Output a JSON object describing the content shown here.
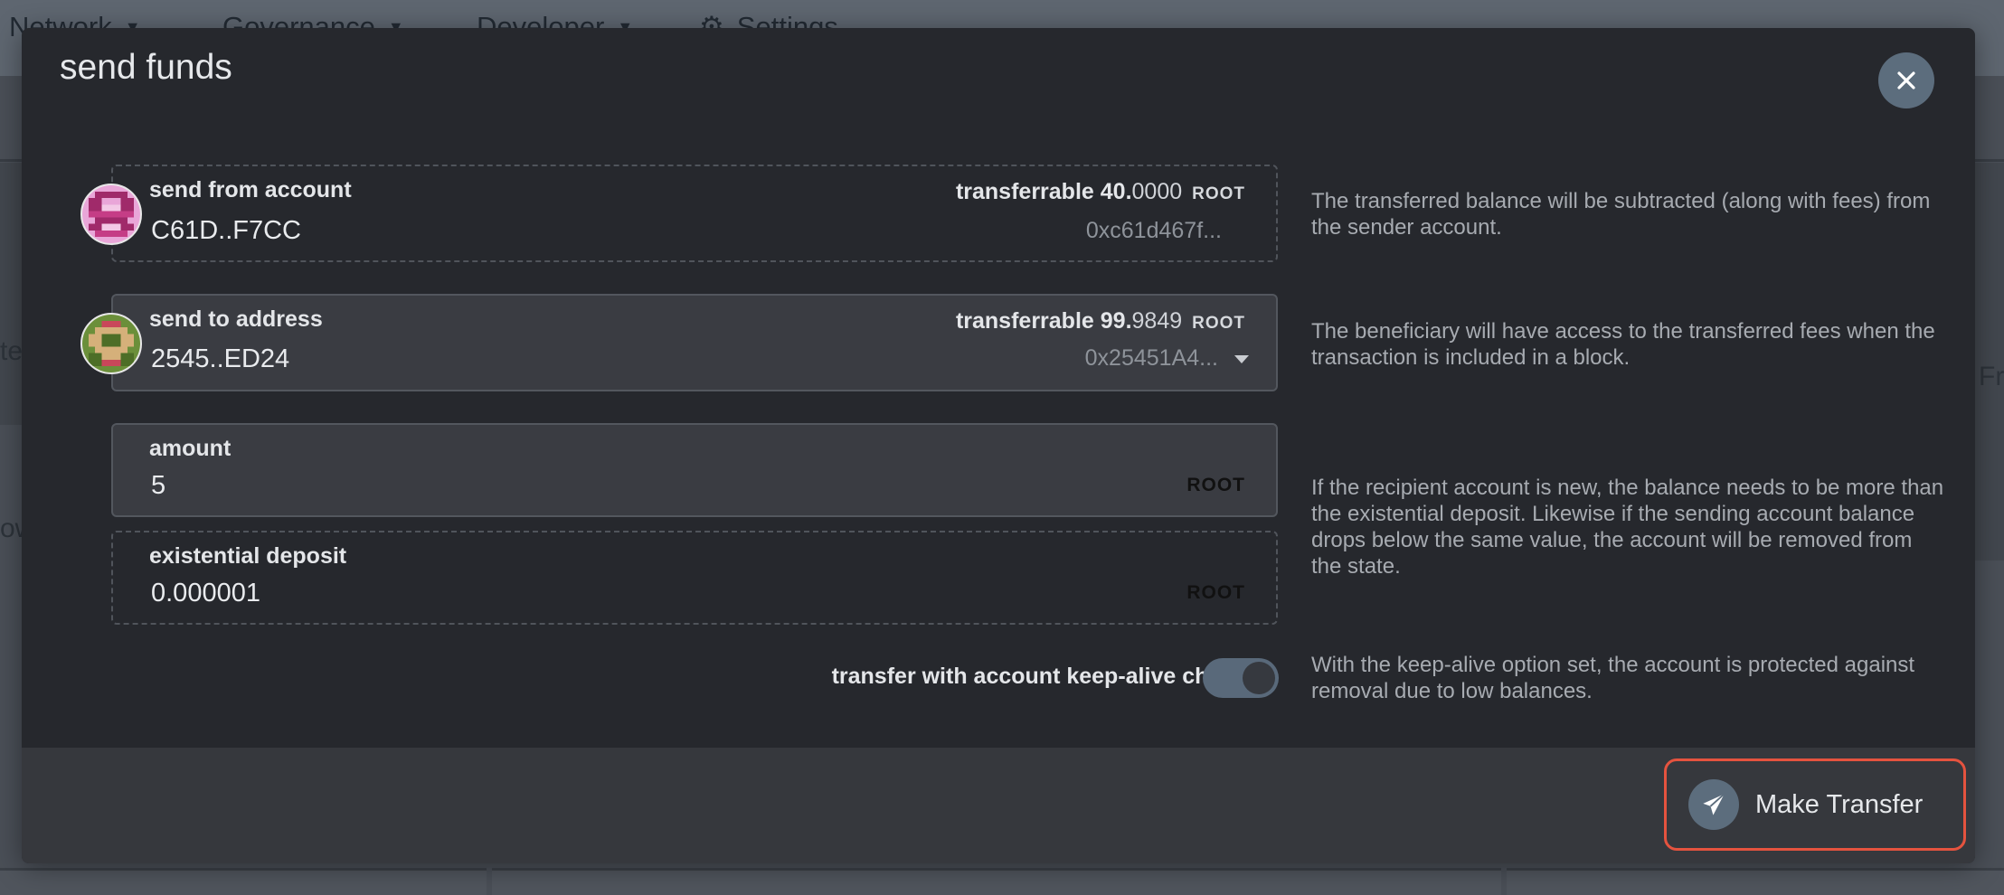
{
  "background": {
    "menu": [
      {
        "label": "Network"
      },
      {
        "label": "Governance"
      },
      {
        "label": "Developer"
      },
      {
        "label": "Settings"
      }
    ],
    "fragments": {
      "left_top": "te",
      "left_mid": "ow",
      "right_mid": "Fr"
    }
  },
  "modal": {
    "title": "send funds",
    "close_icon": "close-icon",
    "from": {
      "label": "send from account",
      "value": "C61D..F7CC",
      "balance_label": "transferrable",
      "balance_int": "40.",
      "balance_dec": "0000",
      "unit": "ROOT",
      "address": "0xc61d467f...",
      "help": "The transferred balance will be subtracted (along with fees) from the sender account."
    },
    "to": {
      "label": "send to address",
      "value": "2545..ED24",
      "balance_label": "transferrable",
      "balance_int": "99.",
      "balance_dec": "9849",
      "unit": "ROOT",
      "address": "0x25451A4...",
      "help": "The beneficiary will have access to the transferred fees when the transaction is included in a block."
    },
    "amount": {
      "label": "amount",
      "value": "5",
      "unit": "ROOT",
      "help": "If the recipient account is new, the balance needs to be more than the existential deposit. Likewise if the sending account balance drops below the same value, the account will be removed from the state."
    },
    "existential": {
      "label": "existential deposit",
      "value": "0.000001",
      "unit": "ROOT"
    },
    "keep_alive": {
      "label": "transfer with account keep-alive checks",
      "enabled": true,
      "help": "With the keep-alive option set, the account is protected against removal due to low balances."
    },
    "footer": {
      "button_label": "Make Transfer",
      "button_icon": "paper-plane-icon"
    }
  },
  "colors": {
    "modal_bg": "#26282d",
    "footer_bg": "#36383d",
    "accent": "#5c6d7d",
    "highlight_border": "#e5533f"
  }
}
